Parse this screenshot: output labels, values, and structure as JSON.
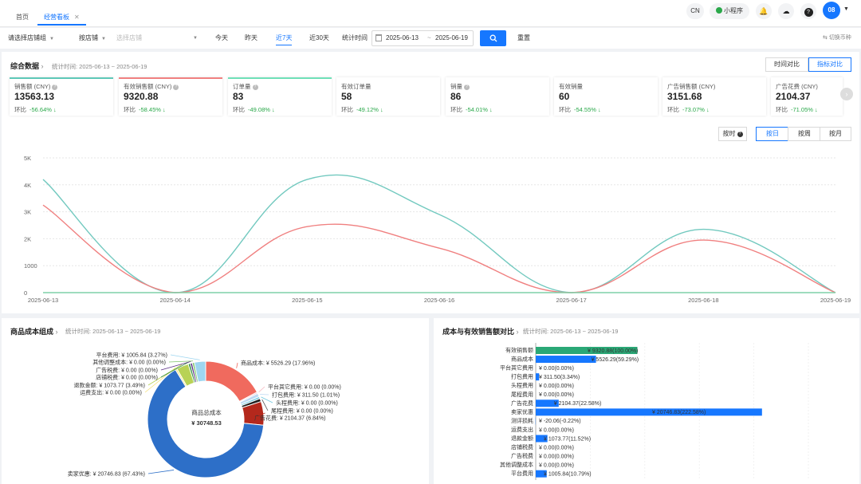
{
  "tabs": {
    "home": "首页",
    "dashboard": "经营看板",
    "close": "✕"
  },
  "topright": {
    "lang": "CN",
    "miniapp": "小程序",
    "bell_icon": "🔔",
    "cloud_icon": "☁",
    "help_icon": "?",
    "avatar": "08",
    "avatar_caret": "▼"
  },
  "filters": {
    "store_group": "请选择店铺组",
    "by_store": "按店铺",
    "store_placeholder": "选择店铺",
    "quick": [
      "今天",
      "昨天",
      "近7天",
      "近30天"
    ],
    "stat_time_label": "统计时间",
    "date_start": "2025-06-13",
    "date_sep": "~",
    "date_end": "2025-06-19",
    "reset": "重置",
    "switch_currency": "切换币种"
  },
  "summary": {
    "title": "综合数据",
    "subtitle": "统计时间: 2025-06-13 ~ 2025-06-19",
    "time_compare": "时间对比",
    "metric_compare": "指标对比",
    "cards": [
      {
        "label": "销售额 (CNY)",
        "value": "13563.13",
        "cmp_label": "环比",
        "cmp": "-56.64% ↓",
        "color": "#5ec8b8",
        "q": true
      },
      {
        "label": "有效销售额 (CNY)",
        "value": "9320.88",
        "cmp_label": "环比",
        "cmp": "-58.45% ↓",
        "color": "#f08080",
        "q": true
      },
      {
        "label": "订单量",
        "value": "83",
        "cmp_label": "环比",
        "cmp": "-49.08% ↓",
        "color": "#6fe0b8",
        "q": true
      },
      {
        "label": "有效订单量",
        "value": "58",
        "cmp_label": "环比",
        "cmp": "-49.12% ↓",
        "color": "",
        "q": false
      },
      {
        "label": "销量",
        "value": "86",
        "cmp_label": "环比",
        "cmp": "-54.01% ↓",
        "color": "",
        "q": true
      },
      {
        "label": "有效销量",
        "value": "60",
        "cmp_label": "环比",
        "cmp": "-54.55% ↓",
        "color": "",
        "q": false
      },
      {
        "label": "广告销售额 (CNY)",
        "value": "3151.68",
        "cmp_label": "环比",
        "cmp": "-73.07% ↓",
        "color": "",
        "q": false
      },
      {
        "label": "广告花费 (CNY)",
        "value": "2104.37",
        "cmp_label": "环比",
        "cmp": "-71.05% ↓",
        "color": "",
        "q": false
      }
    ],
    "next_icon": "›",
    "granularity": [
      "按时",
      "按日",
      "按周",
      "按月"
    ],
    "granularity_active": "按日"
  },
  "chart_data": [
    {
      "type": "line",
      "x": [
        "2025-06-13",
        "2025-06-14",
        "2025-06-15",
        "2025-06-16",
        "2025-06-17",
        "2025-06-18",
        "2025-06-19"
      ],
      "series": [
        {
          "values": [
            4200,
            0,
            4200,
            2900,
            0,
            2350,
            0
          ],
          "color": "#72c9bf"
        },
        {
          "values": [
            3250,
            0,
            2450,
            1650,
            0,
            1950,
            0
          ],
          "color": "#f08080"
        },
        {
          "values": [
            0,
            0,
            0,
            0,
            0,
            0,
            0
          ],
          "color": "#7fd0a8"
        }
      ],
      "yticks": [
        "0",
        "1000",
        "2K",
        "3K",
        "4K",
        "5K"
      ],
      "ylim": [
        0,
        5000
      ],
      "grid": true
    },
    {
      "type": "pie",
      "title": "商品成本组成",
      "subtitle": "统计时间: 2025-06-13 ~ 2025-06-19",
      "center_label": "商品总成本",
      "center_value": "¥ 30748.53",
      "slices": [
        {
          "label": "商品成本: ¥ 5526.29 (17.96%)",
          "value": 17.96,
          "color": "#f06a5e"
        },
        {
          "label": "平台其它费用: ¥ 0.00 (0.00%)",
          "value": 0.4,
          "color": "#f6b8c0"
        },
        {
          "label": "打包费用: ¥ 311.50 (1.01%)",
          "value": 1.01,
          "color": "#bdd8f2"
        },
        {
          "label": "头程费用: ¥ 0.00 (0.00%)",
          "value": 0.6,
          "color": "#70c8e0"
        },
        {
          "label": "尾程费用: ¥ 0.00 (0.00%)",
          "value": 0.9,
          "color": "#222222"
        },
        {
          "label": "广告花费: ¥ 2104.37 (6.84%)",
          "value": 6.84,
          "color": "#b4281c"
        },
        {
          "label": "卖家优惠: ¥ 20746.83 (67.43%)",
          "value": 67.43,
          "color": "#2d6fc8"
        },
        {
          "label": "运费支出: ¥ 0.00 (0.00%)",
          "value": 0.5,
          "color": "#f5e27a"
        },
        {
          "label": "退款金额: ¥ 1073.77 (3.49%)",
          "value": 3.49,
          "color": "#b8d255"
        },
        {
          "label": "店铺税费: ¥ 0.00 (0.00%)",
          "value": 0.6,
          "color": "#2e8a3e"
        },
        {
          "label": "广告税费: ¥ 0.00 (0.00%)",
          "value": 0.6,
          "color": "#5a2d86"
        },
        {
          "label": "其他调整成本: ¥ 0.00 (0.00%)",
          "value": 0.6,
          "color": "#7ec46a"
        },
        {
          "label": "平台费用: ¥ 1005.84 (3.27%)",
          "value": 3.27,
          "color": "#9ed6f0"
        }
      ]
    },
    {
      "type": "bar",
      "title": "成本与有效销售额对比",
      "subtitle": "统计时间: 2025-06-13 ~ 2025-06-19",
      "categories": [
        "有效销售额",
        "商品成本",
        "平台其它费用",
        "打包费用",
        "头程费用",
        "尾程费用",
        "广告花费",
        "卖家优惠",
        "测评损耗",
        "运费支出",
        "退款金额",
        "店铺税费",
        "广告税费",
        "其他调整成本",
        "平台费用"
      ],
      "values": [
        9320.88,
        5526.29,
        0,
        311.5,
        0,
        0,
        2104.37,
        20746.83,
        -20.06,
        0,
        1073.77,
        0,
        0,
        0,
        1005.84
      ],
      "labels": [
        "¥ 9320.88(100.00%)",
        "¥ 5526.29(59.29%)",
        "¥ 0.00(0.00%)",
        "¥ 311.50(3.34%)",
        "¥ 0.00(0.00%)",
        "¥ 0.00(0.00%)",
        "¥ 2104.37(22.58%)",
        "¥ 20746.83(222.58%)",
        "¥ -20.06(-0.22%)",
        "¥ 0.00(0.00%)",
        "¥ 1073.77(11.52%)",
        "¥ 0.00(0.00%)",
        "¥ 0.00(0.00%)",
        "¥ 0.00(0.00%)",
        "¥ 1005.84(10.79%)"
      ],
      "colors": {
        "first": "#2aa876",
        "rest": "#1677ff"
      },
      "xlim": [
        0,
        25000
      ]
    }
  ]
}
